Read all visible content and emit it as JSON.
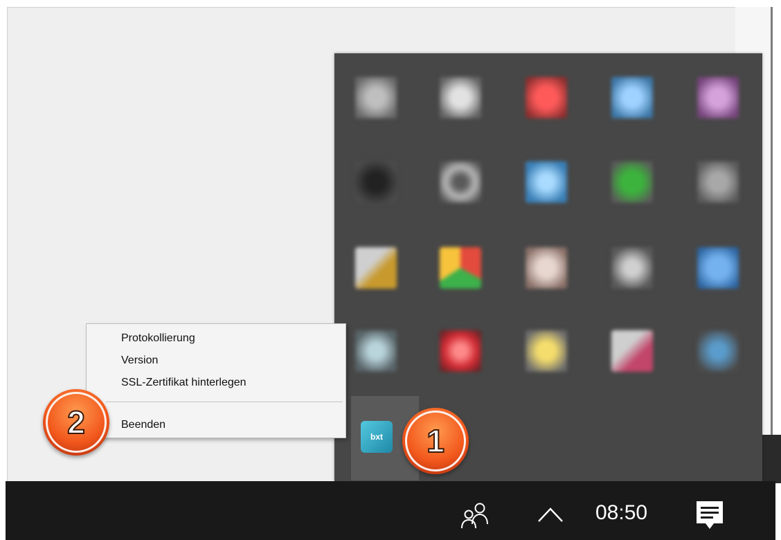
{
  "context_menu": {
    "items": [
      {
        "label": "Protokollierung"
      },
      {
        "label": "Version"
      },
      {
        "label": "SSL-Zertifikat hinterlegen"
      },
      {
        "label": "Beenden"
      }
    ]
  },
  "app_icon": {
    "text": "bxt",
    "icon": "app-tray-icon"
  },
  "badges": {
    "one": "1",
    "two": "2"
  },
  "taskbar": {
    "clock": "08:50",
    "icons": [
      "people-icon",
      "chevron-up-icon",
      "action-center-icon"
    ]
  },
  "colors": {
    "flyout": "#474747",
    "taskbar": "#191919",
    "badge": "#f2581c",
    "app_icon": "#2aa8c4"
  }
}
